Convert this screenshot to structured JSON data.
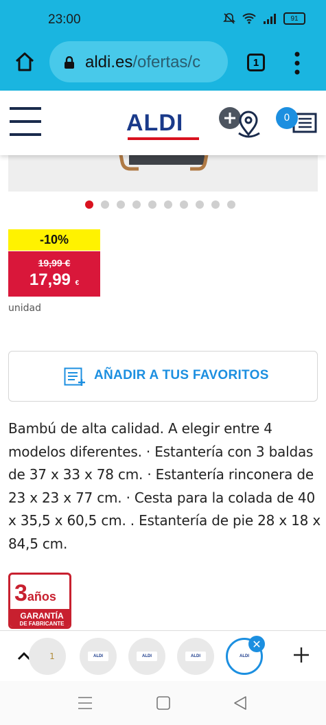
{
  "status_bar": {
    "time": "23:00",
    "battery": "91"
  },
  "browser": {
    "url_domain": "aldi.es",
    "url_path": "/ofertas/c",
    "tab_count": "1"
  },
  "header": {
    "logo": "ALDI",
    "cart_count": "0"
  },
  "carousel": {
    "total_dots": 10,
    "active_index": 0
  },
  "product": {
    "discount": "-10%",
    "old_price": "19,99 €",
    "new_price": "17,99",
    "currency": "€",
    "unit": "unidad",
    "favorites_label": "AÑADIR A TUS FAVORITOS",
    "description": "Bambú de alta calidad. A elegir entre 4 modelos diferentes. · Estantería con 3 baldas de 37 x 33 x 78 cm. · Estantería rinconera de 23 x 23 x 77 cm. · Cesta para la colada de 40 x 35,5 x 60,5 cm. . Estantería de pie 28 x 18 x 84,5 cm."
  },
  "warranty": {
    "number": "3",
    "word": "años",
    "line1": "GARANTÍA",
    "line2": "DE FABRICANTE"
  },
  "tab_switcher": {
    "thumb_label": "ALDI",
    "partial_thumb_text": "1"
  },
  "colors": {
    "accent": "#1ab5e0",
    "aldi_blue": "#1a3a8a",
    "aldi_red": "#d9121f",
    "link_blue": "#1c8fe0",
    "price_red": "#d9173a",
    "discount_yellow": "#fff200"
  }
}
